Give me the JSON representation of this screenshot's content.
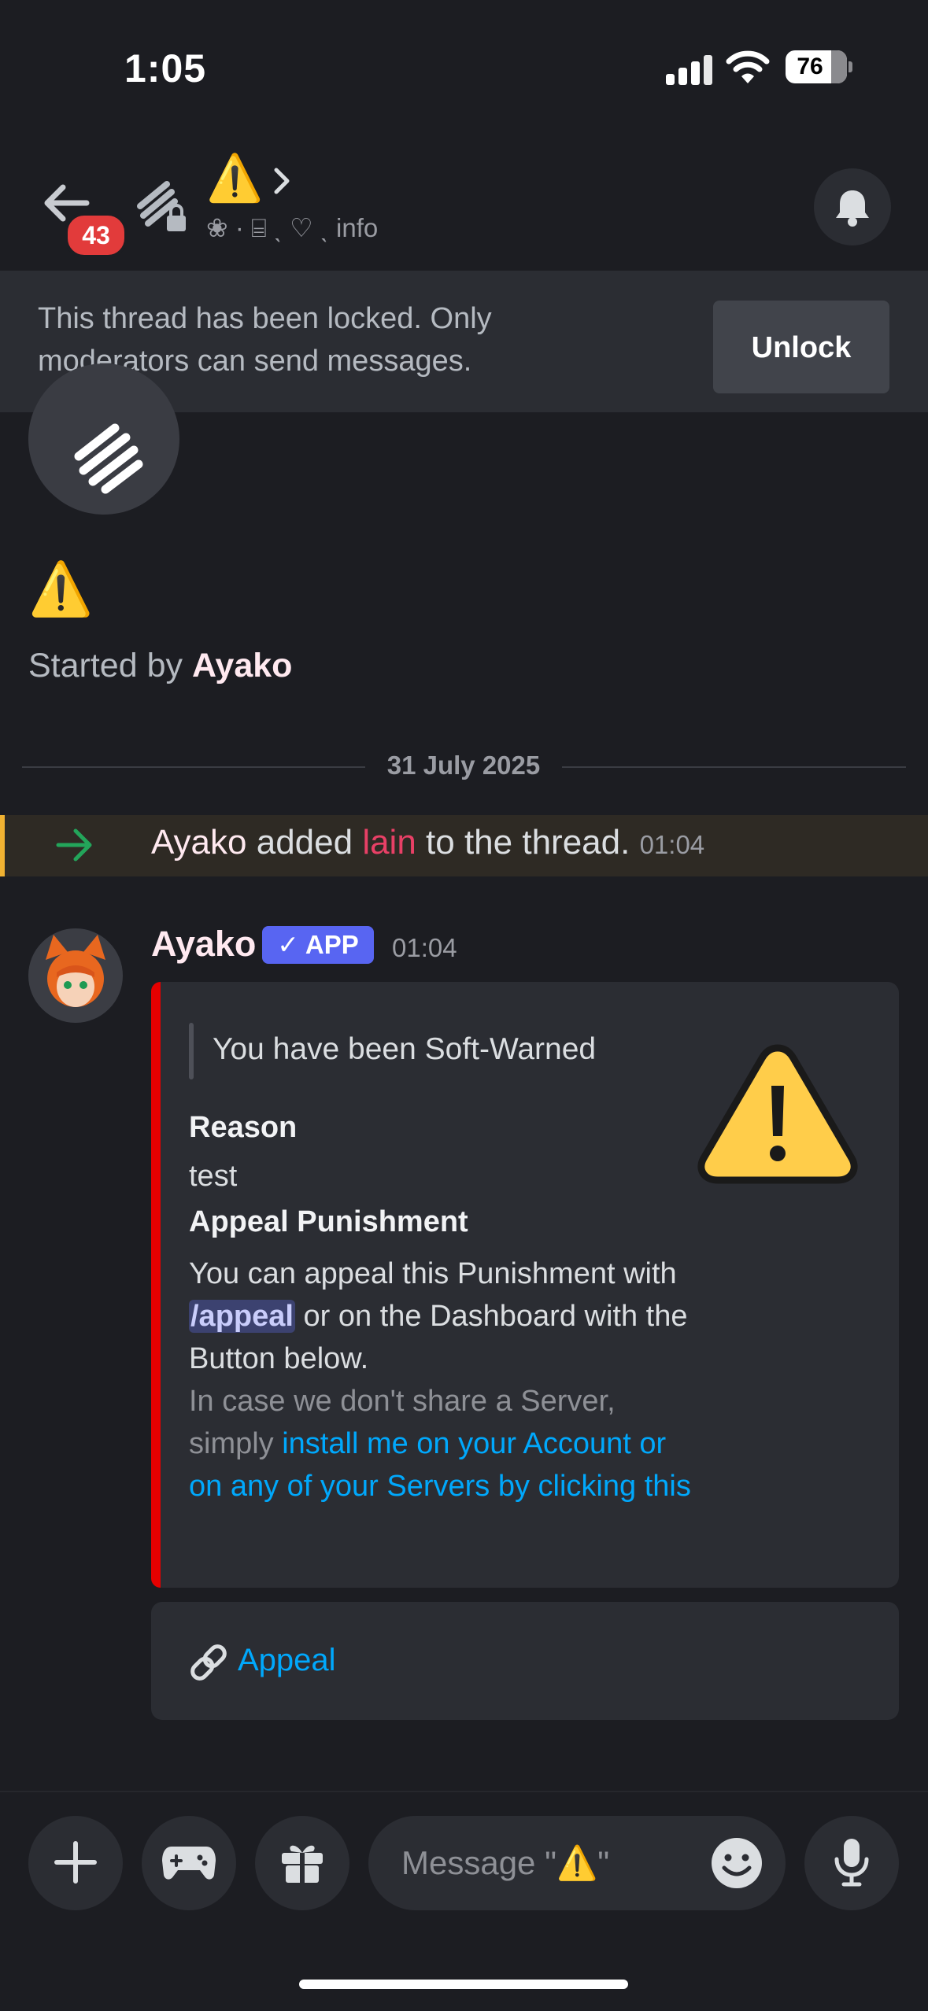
{
  "status_bar": {
    "time": "1:05",
    "battery": "76"
  },
  "header": {
    "unread_badge": "43",
    "title_emoji": "⚠️",
    "subtitle": "❀ · ⌸ ˎ ♡ ˎ info"
  },
  "lock_banner": {
    "text": "This thread has been locked. Only moderators can send messages.",
    "unlock_label": "Unlock"
  },
  "thread_intro": {
    "emoji": "⚠️",
    "started_prefix": "Started by ",
    "started_user": "Ayako"
  },
  "date_divider": "31 July 2025",
  "system_message": {
    "user": "Ayako",
    "verb": " added ",
    "target": "lain",
    "suffix": " to the thread.",
    "time": "01:04"
  },
  "message": {
    "author": "Ayako",
    "tag": "✓ APP",
    "time": "01:04",
    "embed": {
      "color": "#e50000",
      "quote": "You have been Soft-Warned",
      "field1_name": "Reason",
      "field1_value": "test",
      "field2_name": "Appeal Punishment",
      "field2_line1": "You can appeal this Punishment with ",
      "field2_command": "/appeal",
      "field2_line2": " or on the Dashboard with the Button below.",
      "field2_muted": "In case we don't share a Server, simply ",
      "field2_link": "install me on your Account or on any of your Servers by clicking this",
      "thumbnail_icon": "warning-triangle-icon"
    },
    "button": {
      "icon": "link-icon",
      "label": "Appeal"
    }
  },
  "composer": {
    "placeholder": "Message \"⚠️\""
  }
}
